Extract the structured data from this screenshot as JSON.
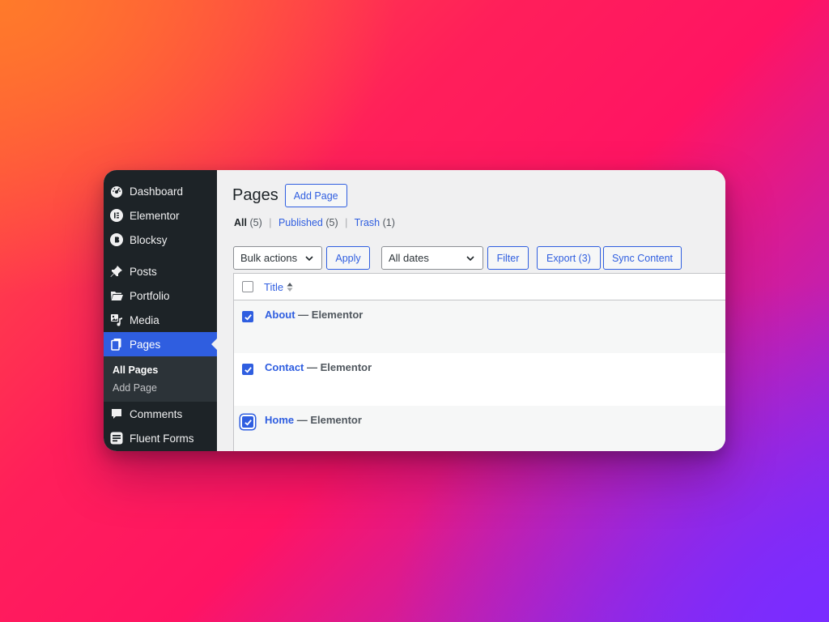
{
  "sidebar": {
    "items": [
      {
        "label": "Dashboard",
        "icon": "dashboard-icon"
      },
      {
        "label": "Elementor",
        "icon": "elementor-icon"
      },
      {
        "label": "Blocksy",
        "icon": "blocksy-icon"
      },
      {
        "label": "Posts",
        "icon": "pin-icon"
      },
      {
        "label": "Portfolio",
        "icon": "folder-icon"
      },
      {
        "label": "Media",
        "icon": "media-icon"
      },
      {
        "label": "Pages",
        "icon": "pages-icon",
        "active": true
      },
      {
        "label": "Comments",
        "icon": "comment-icon"
      },
      {
        "label": "Fluent Forms",
        "icon": "forms-icon"
      }
    ],
    "submenu": [
      {
        "label": "All Pages",
        "current": true
      },
      {
        "label": "Add Page"
      }
    ]
  },
  "header": {
    "title": "Pages",
    "add_button": "Add Page"
  },
  "views": {
    "all": {
      "label": "All",
      "count": "(5)"
    },
    "published": {
      "label": "Published",
      "count": "(5)"
    },
    "trash": {
      "label": "Trash",
      "count": "(1)"
    },
    "separator": "|"
  },
  "toolbar": {
    "bulk_actions": "Bulk actions",
    "apply": "Apply",
    "dates": "All dates",
    "filter": "Filter",
    "export": "Export (3)",
    "sync": "Sync Content"
  },
  "table": {
    "column_title": "Title",
    "rows": [
      {
        "title": "About",
        "suffix": " — Elementor",
        "checked": true
      },
      {
        "title": "Contact",
        "suffix": " — Elementor",
        "checked": true
      },
      {
        "title": "Home",
        "suffix": " — Elementor",
        "checked": true
      }
    ]
  },
  "colors": {
    "accent": "#2f5ee0",
    "sidebar_bg": "#1d2327",
    "content_bg": "#f0f0f1"
  }
}
